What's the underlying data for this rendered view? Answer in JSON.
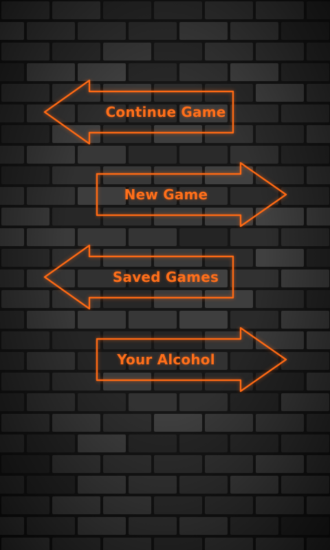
{
  "menu": {
    "continue_label": "Continue Game",
    "new_label": "New Game",
    "saved_label": "Saved Games",
    "alcohol_label": "Your Alcohol"
  },
  "colors": {
    "accent": "#ff6a14",
    "background": "#1b1b1b"
  },
  "icons": {
    "left_arrow": "left-arrow-outline",
    "right_arrow": "right-arrow-outline"
  }
}
